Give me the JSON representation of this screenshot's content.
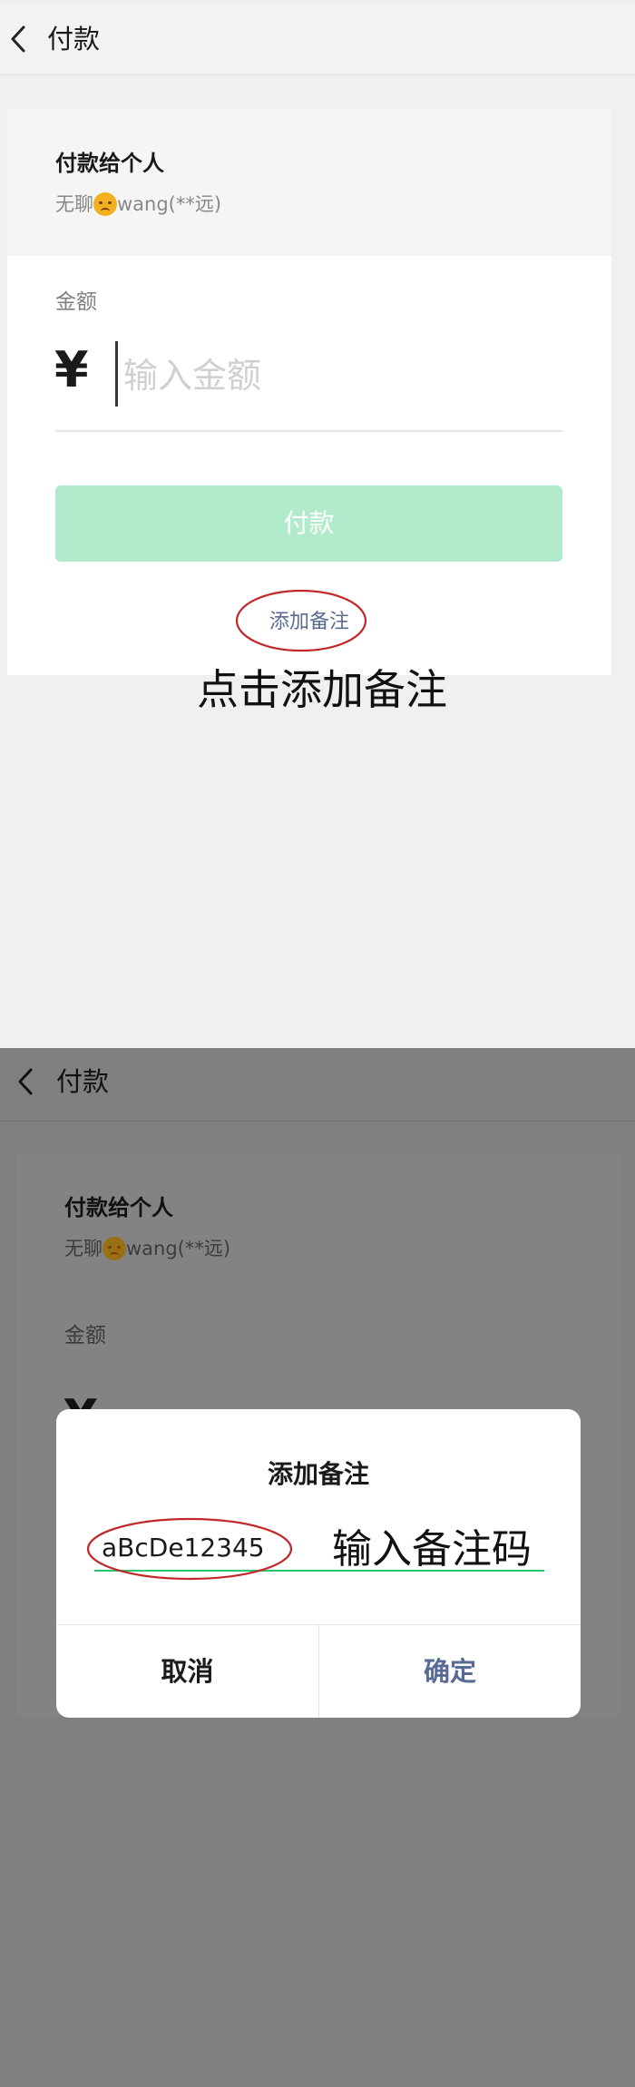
{
  "step1": {
    "nav": {
      "title": "付款"
    },
    "payee": {
      "title": "付款给个人",
      "name_prefix": "无聊",
      "name_suffix": "wang(**远)",
      "emoji_icon": "disappointed-face-emoji"
    },
    "amount": {
      "label": "金额",
      "currency": "¥",
      "placeholder": "输入金额"
    },
    "pay_button": {
      "label": "付款",
      "color": "#b2ebcb"
    },
    "add_remark": {
      "label": "添加备注",
      "color": "#5b6b93"
    },
    "caption": "点击添加备注",
    "highlight_color": "#c0282a"
  },
  "step2": {
    "nav": {
      "title": "付款"
    },
    "payee": {
      "title": "付款给个人",
      "name_prefix": "无聊",
      "name_suffix": "wang(**远)"
    },
    "amount": {
      "label": "金额",
      "currency": "¥"
    },
    "dialog": {
      "title": "添加备注",
      "input_value": "aBcDe12345",
      "caption": "输入备注码",
      "cancel_label": "取消",
      "confirm_label": "确定",
      "confirm_color": "#576b95",
      "input_line_color": "#28c76f"
    },
    "overlay_color": "#808080"
  }
}
